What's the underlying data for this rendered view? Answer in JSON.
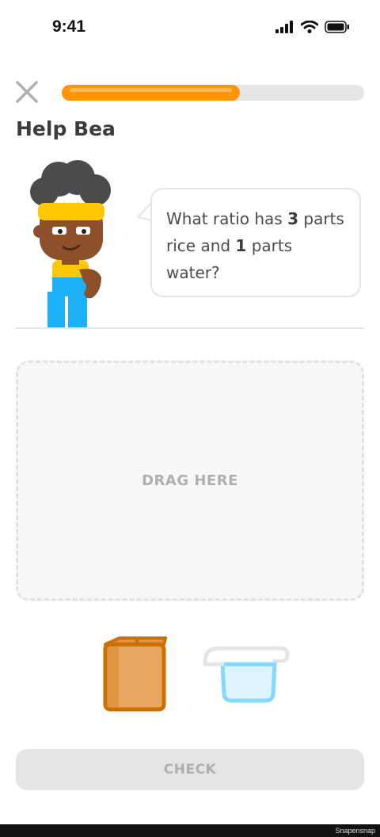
{
  "status_bar": {
    "time": "9:41",
    "icons": [
      "signal-icon",
      "wifi-icon",
      "battery-icon"
    ]
  },
  "header": {
    "close_icon": "close-icon",
    "progress": 0.59,
    "progress_color": "#ff9600"
  },
  "lesson": {
    "title": "Help Bea",
    "prompt_prefix": "What ratio has ",
    "prompt_num1": "3",
    "prompt_mid": " parts rice and ",
    "prompt_num2": "1",
    "prompt_suffix": " parts water?"
  },
  "drop_zone": {
    "label": "DRAG HERE"
  },
  "choices": [
    {
      "name": "rice",
      "icon": "rice-box-icon",
      "color": "#e09640"
    },
    {
      "name": "water",
      "icon": "water-cup-icon",
      "color": "#84d8ff"
    }
  ],
  "footer": {
    "check_label": "CHECK",
    "watermark": "Snapensnap"
  }
}
